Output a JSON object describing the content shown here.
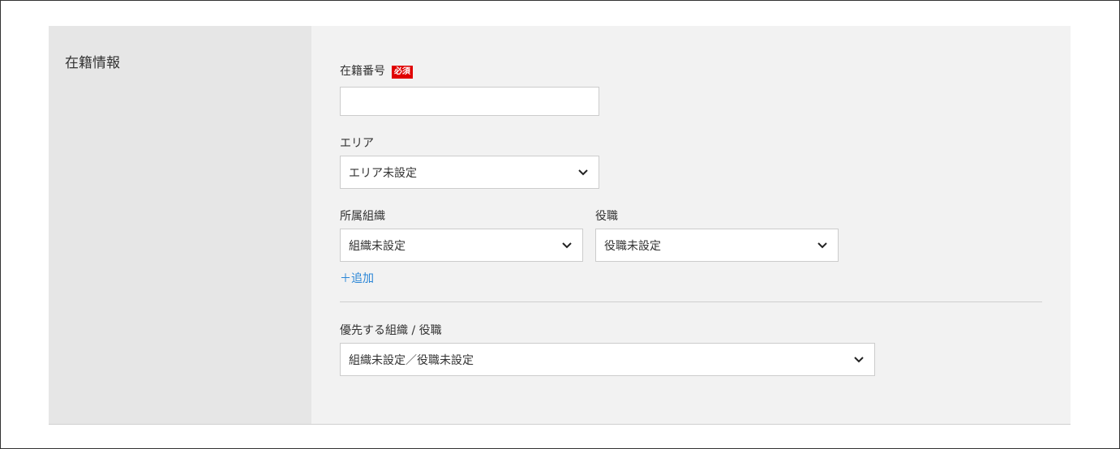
{
  "section": {
    "title": "在籍情報"
  },
  "fields": {
    "employee_number": {
      "label": "在籍番号",
      "required_badge": "必須",
      "value": ""
    },
    "area": {
      "label": "エリア",
      "value": "エリア未設定"
    },
    "organization": {
      "label": "所属組織",
      "value": "組織未設定"
    },
    "position": {
      "label": "役職",
      "value": "役職未設定"
    },
    "add_link": "＋追加",
    "priority": {
      "label": "優先する組織 / 役職",
      "value": "組織未設定／役職未設定"
    }
  },
  "icons": {
    "dropdown": "chevron-down-icon"
  },
  "colors": {
    "required": "#e00000",
    "link": "#2a86d6",
    "sidebar_bg": "#e6e6e6",
    "panel_bg": "#f2f2f2"
  }
}
